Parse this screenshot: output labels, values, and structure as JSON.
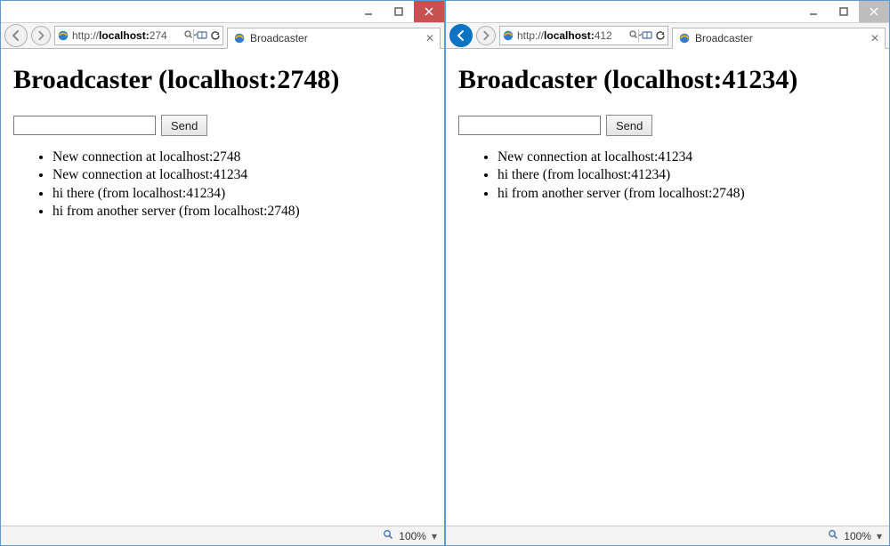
{
  "windows": [
    {
      "addressbar_prefix": "http://",
      "addressbar_host": "localhost:",
      "addressbar_tail": "274",
      "tab_title": "Broadcaster",
      "page_heading": "Broadcaster (localhost:2748)",
      "send_label": "Send",
      "messages": [
        "New connection at localhost:2748",
        "New connection at localhost:41234",
        "hi there (from localhost:41234)",
        "hi from another server (from localhost:2748)"
      ],
      "zoom": "100%",
      "back_active": false,
      "close_enabled": true
    },
    {
      "addressbar_prefix": "http://",
      "addressbar_host": "localhost:",
      "addressbar_tail": "412",
      "tab_title": "Broadcaster",
      "page_heading": "Broadcaster (localhost:41234)",
      "send_label": "Send",
      "messages": [
        "New connection at localhost:41234",
        "hi there (from localhost:41234)",
        "hi from another server (from localhost:2748)"
      ],
      "zoom": "100%",
      "back_active": true,
      "close_enabled": false
    }
  ]
}
